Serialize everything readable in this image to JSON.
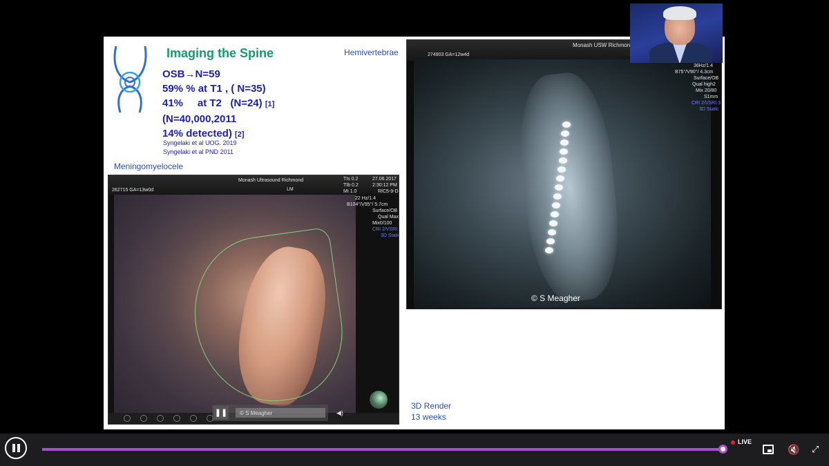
{
  "slide": {
    "title": "Imaging the Spine",
    "label_hemivertebrae": "Hemivertebrae",
    "stats": {
      "line1": "OSB→N=59",
      "line2": "59% % at T1 , ( N=35)",
      "line3a": "41%     at T2   (N=24)",
      "line3_ref": "[1]",
      "line4": "(N=40,000,2011",
      "line5": "14% detected)",
      "line5_ref": "[2]"
    },
    "references": [
      "Syngelaki et al UOG. 2019",
      "Syngelaki et al PND 2011"
    ],
    "label_meningomyelocele": "Meningomyelocele",
    "render_caption_1": "3D Render",
    "render_caption_2": "13 weeks"
  },
  "ultrasound_1": {
    "patient": "262715  GA=13w0d",
    "site": "Monash Ultrasound Richmond",
    "mode": "LM",
    "params_left": [
      "TIs  0.2",
      "TIb  0.2",
      "MI   1.0"
    ],
    "date": "27.06.2017",
    "time": "2:30:12 PM",
    "probe": "RIC5-9-D",
    "settings": [
      "22 Hz/1.4",
      "B104°/V95°/ 5.7cm",
      "Surface/OB",
      "Qual Max",
      "Mix0/100"
    ],
    "settings_blue": [
      "CRI 2/VSRI 3",
      "3D Static"
    ],
    "video_credit": "© S Meagher",
    "play_icon_label": "❚❚",
    "volume_icon_label": "◀)"
  },
  "ultrasound_2": {
    "patient": "274903  GA=12w4d",
    "site": "Monash USW Richmon",
    "settings": [
      "36Hz/1.4",
      "B75°/V90°/ 4.3cm",
      "Surface/OB",
      "Qual high2",
      "Mix 20/80",
      "S1mm"
    ],
    "settings_blue": [
      "CRI 2/VSRI 3",
      "3D Static"
    ],
    "credit": "© S Meagher"
  },
  "player": {
    "progress_fraction": 0.993,
    "live_label": "LIVE",
    "live_color": "#e0242c",
    "accent_color": "#a84fd0",
    "icons": [
      "pause-icon",
      "picture-in-picture-icon",
      "mute-icon",
      "exit-fullscreen-icon"
    ]
  }
}
